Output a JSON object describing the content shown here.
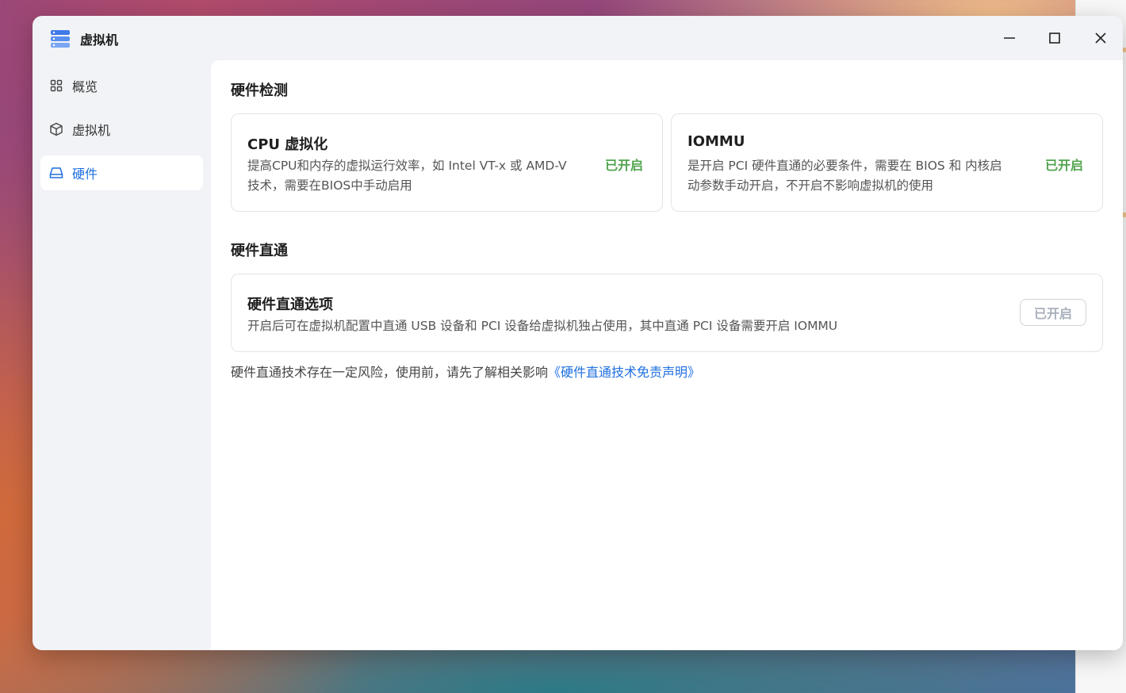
{
  "window": {
    "title": "虚拟机",
    "accent_color": "#1e6fe0",
    "status_color": "#52a44e"
  },
  "sidebar": {
    "items": [
      {
        "label": "概览",
        "icon": "grid-icon"
      },
      {
        "label": "虚拟机",
        "icon": "cube-icon"
      },
      {
        "label": "硬件",
        "icon": "drive-icon",
        "active": true
      }
    ]
  },
  "hardware_detection": {
    "title": "硬件检测",
    "cards": [
      {
        "title": "CPU 虚拟化",
        "desc_line1": "提高CPU和内存的虚拟运行效率，如 Intel VT-x 或 AMD-V",
        "desc_line2": "技术，需要在BIOS中手动启用",
        "status": "已开启"
      },
      {
        "title": "IOMMU",
        "desc_line1": "是开启 PCI 硬件直通的必要条件，需要在 BIOS 和 内核启",
        "desc_line2": "动参数手动开启，不开启不影响虚拟机的使用",
        "status": "已开启"
      }
    ]
  },
  "passthrough": {
    "title": "硬件直通",
    "card": {
      "title": "硬件直通选项",
      "desc": "开启后可在虚拟机配置中直通 USB 设备和 PCI 设备给虚拟机独占使用，其中直通 PCI 设备需要开启 IOMMU",
      "button_label": "已开启"
    },
    "footnote_text": "硬件直通技术存在一定风险，使用前，请先了解相关影响",
    "footnote_link": "《硬件直通技术免责声明》"
  }
}
